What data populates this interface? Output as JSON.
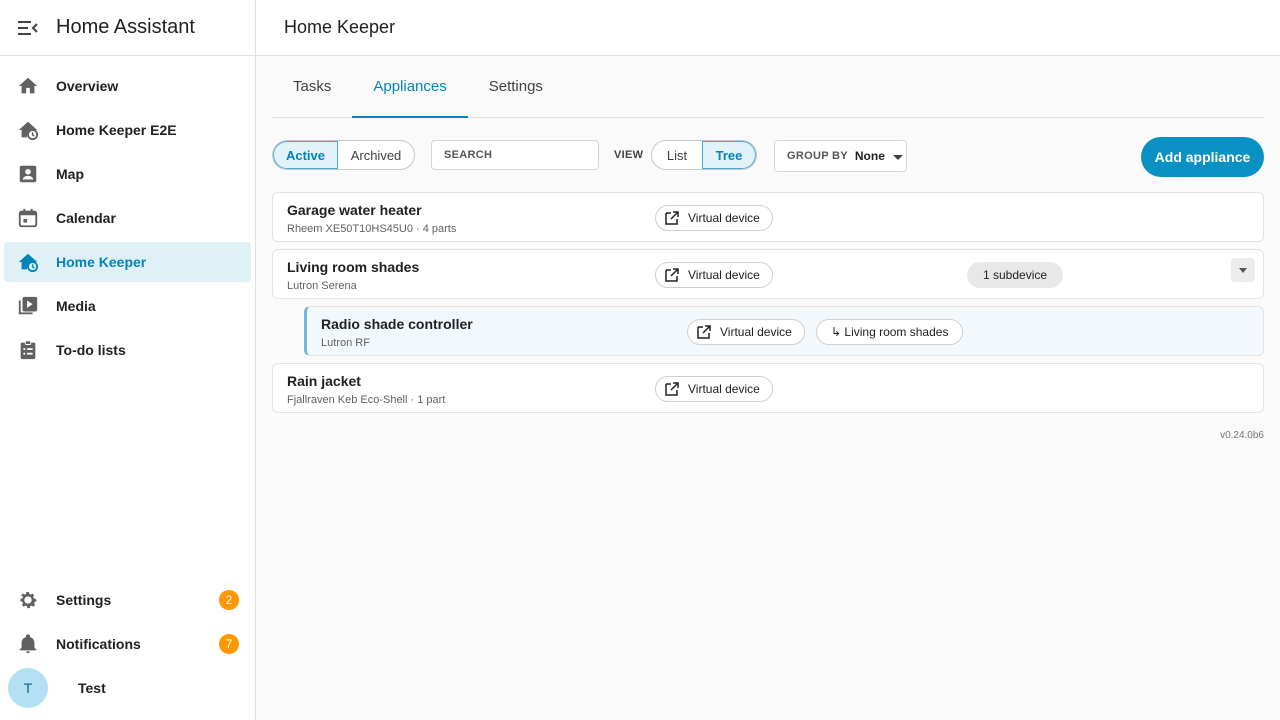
{
  "app": {
    "title": "Home Assistant"
  },
  "sidebar": {
    "items": [
      {
        "label": "Overview",
        "icon": "home-icon"
      },
      {
        "label": "Home Keeper E2E",
        "icon": "home-clock-icon"
      },
      {
        "label": "Map",
        "icon": "account-box-icon"
      },
      {
        "label": "Calendar",
        "icon": "calendar-icon"
      },
      {
        "label": "Home Keeper",
        "icon": "home-clock-icon",
        "active": true
      },
      {
        "label": "Media",
        "icon": "play-box-multiple-icon"
      },
      {
        "label": "To-do lists",
        "icon": "clipboard-list-icon"
      }
    ],
    "bottom": {
      "settings": {
        "label": "Settings",
        "badge": "2"
      },
      "notifications": {
        "label": "Notifications",
        "badge": "7"
      },
      "user": {
        "initial": "T",
        "name": "Test"
      }
    }
  },
  "header": {
    "title": "Home Keeper"
  },
  "tabs": [
    "Tasks",
    "Appliances",
    "Settings"
  ],
  "active_tab": "Appliances",
  "toolbar": {
    "status_options": [
      "Active",
      "Archived"
    ],
    "selected_status": "Active",
    "search_placeholder": "SEARCH",
    "view_label": "VIEW",
    "view_options": [
      "List",
      "Tree"
    ],
    "selected_view": "Tree",
    "group_by_label": "GROUP BY",
    "group_by_value": "None",
    "add_label": "Add appliance"
  },
  "appliances": [
    {
      "name": "Garage water heater",
      "subtitle": "Rheem XE50T10HS45U0 · 4 parts",
      "device": "Virtual device"
    },
    {
      "name": "Living room shades",
      "subtitle": "Lutron Serena",
      "device": "Virtual device",
      "subdevices": "1 subdevice"
    },
    {
      "name": "Radio shade controller",
      "subtitle": "Lutron RF",
      "device": "Virtual device",
      "parent": "↳ Living room shades",
      "child": true
    },
    {
      "name": "Rain jacket",
      "subtitle": "Fjallraven Keb Eco-Shell · 1 part",
      "device": "Virtual device"
    }
  ],
  "version": "v0.24.0b6",
  "colors": {
    "accent": "#0a91c4",
    "badge": "#ff9800",
    "active_bg": "#dff0f7"
  }
}
